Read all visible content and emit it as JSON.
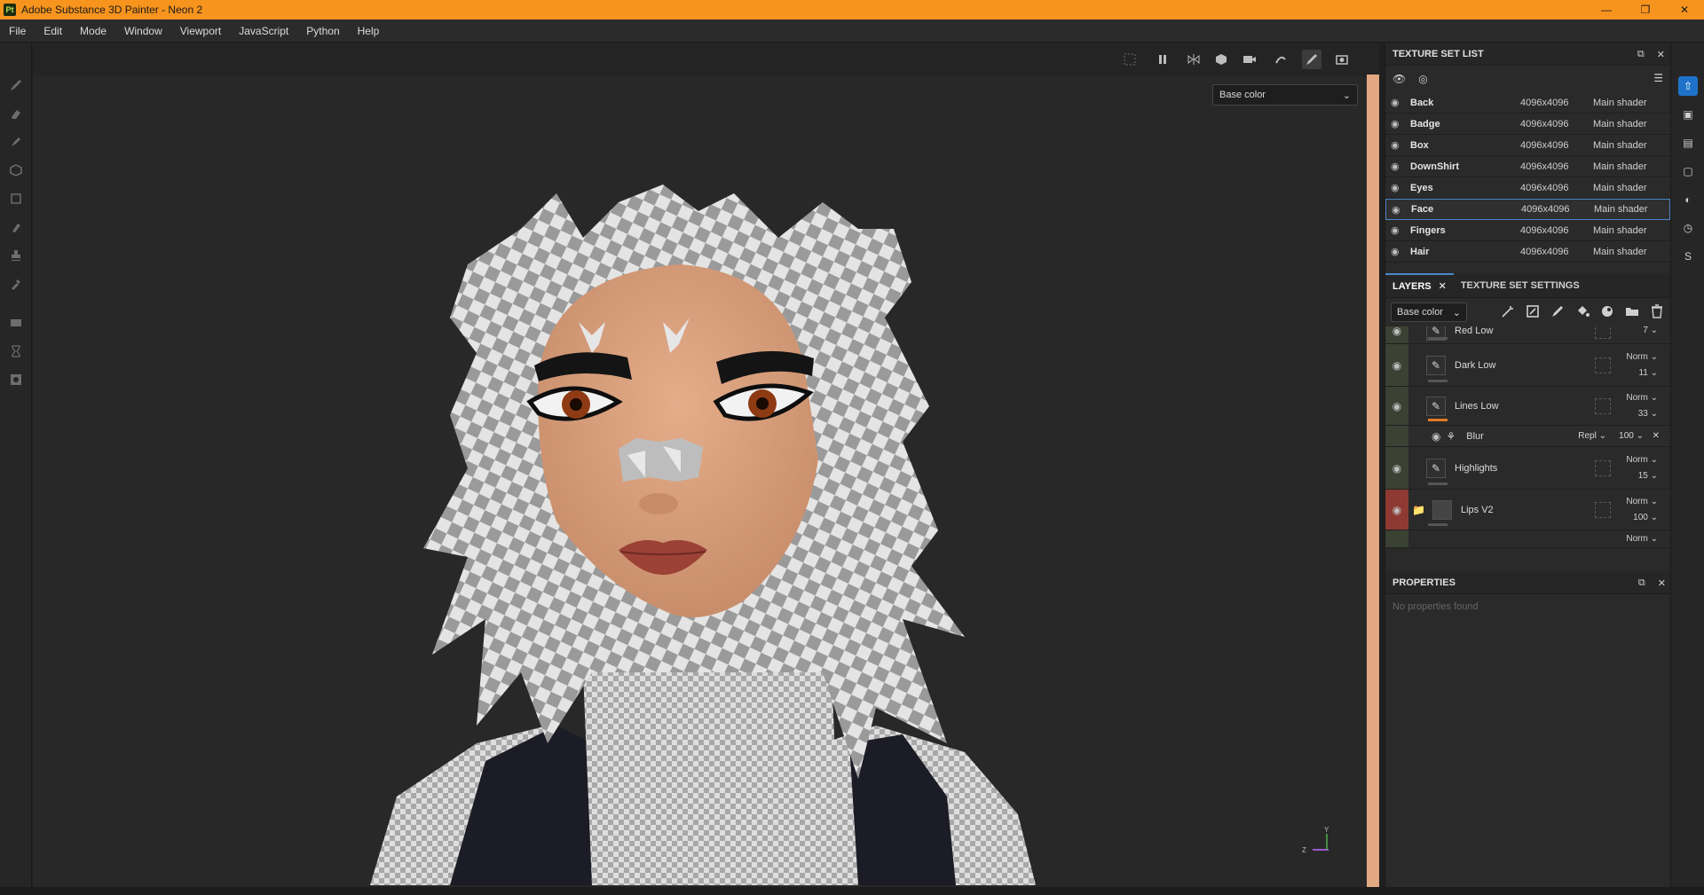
{
  "window": {
    "app_icon": "Pt",
    "title": "Adobe Substance 3D Painter - Neon 2",
    "controls": [
      "minimize-icon",
      "restore-icon",
      "close-icon"
    ]
  },
  "menu": [
    "File",
    "Edit",
    "Mode",
    "Window",
    "Viewport",
    "JavaScript",
    "Python",
    "Help"
  ],
  "viewport": {
    "channel": "Base color",
    "axis": {
      "y": "Y",
      "z": "Z"
    }
  },
  "texture_set_list": {
    "title": "TEXTURE SET LIST",
    "rows": [
      {
        "name": "Back",
        "res": "4096x4096",
        "shader": "Main shader",
        "selected": false
      },
      {
        "name": "Badge",
        "res": "4096x4096",
        "shader": "Main shader",
        "selected": false
      },
      {
        "name": "Box",
        "res": "4096x4096",
        "shader": "Main shader",
        "selected": false
      },
      {
        "name": "DownShirt",
        "res": "4096x4096",
        "shader": "Main shader",
        "selected": false
      },
      {
        "name": "Eyes",
        "res": "4096x4096",
        "shader": "Main shader",
        "selected": false
      },
      {
        "name": "Face",
        "res": "4096x4096",
        "shader": "Main shader",
        "selected": true
      },
      {
        "name": "Fingers",
        "res": "4096x4096",
        "shader": "Main shader",
        "selected": false
      },
      {
        "name": "Hair",
        "res": "4096x4096",
        "shader": "Main shader",
        "selected": false
      }
    ]
  },
  "layers": {
    "tab_layers": "LAYERS",
    "tab_settings": "TEXTURE SET SETTINGS",
    "channel": "Base color",
    "items": [
      {
        "name": "Red Low",
        "blend": "",
        "opacity": "7",
        "bar": "grey"
      },
      {
        "name": "Dark Low",
        "blend": "Norm",
        "opacity": "11",
        "bar": "grey"
      },
      {
        "name": "Lines Low",
        "blend": "Norm",
        "opacity": "33",
        "bar": "orange"
      },
      {
        "name": "Highlights",
        "blend": "Norm",
        "opacity": "15",
        "bar": "grey"
      },
      {
        "name": "Lips V2",
        "blend": "Norm",
        "opacity": "100",
        "bar": "grey"
      }
    ],
    "effect": {
      "name": "Blur",
      "blend": "Repl",
      "opacity": "100"
    },
    "partial_blend": "Norm"
  },
  "properties": {
    "title": "PROPERTIES",
    "empty": "No properties found"
  },
  "colors": {
    "titlebar": "#f7941d",
    "accent_blue": "#1f72c9",
    "layer_green": "#3b4234",
    "layer_red": "#8e3a33",
    "skin": "#e2a882"
  }
}
